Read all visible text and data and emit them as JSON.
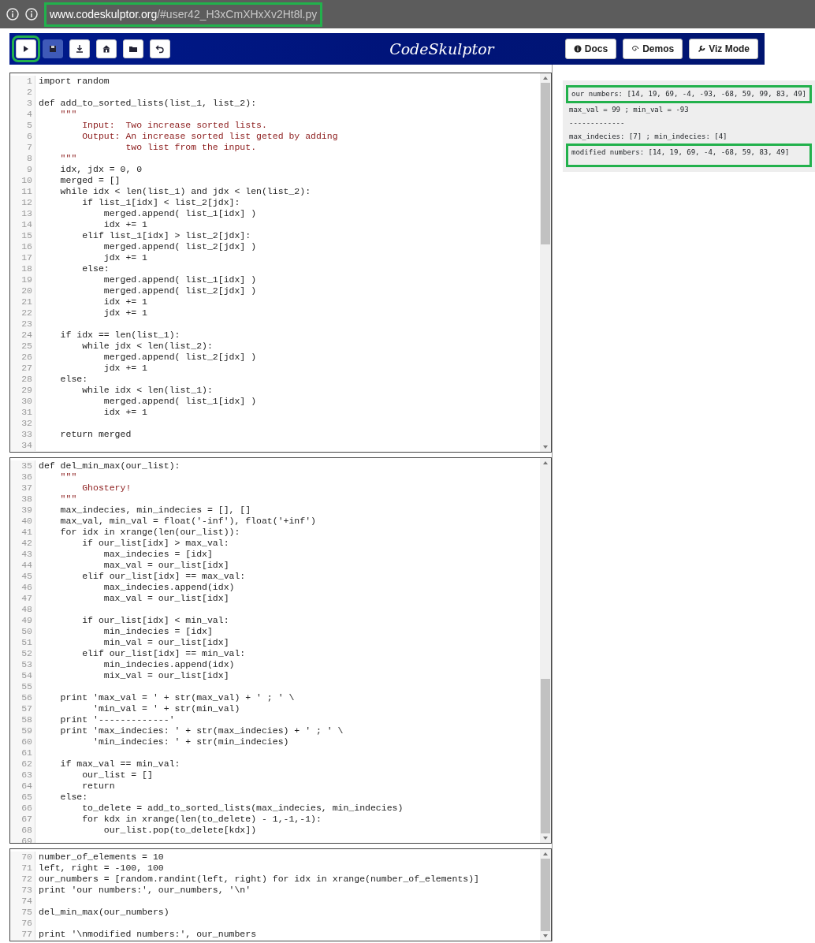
{
  "browser": {
    "url_host": "www.codeskulptor.org",
    "url_path": "/#user42_H3xCmXHxXv2Ht8l.py",
    "highlighted": true
  },
  "toolbar": {
    "tool_buttons": [
      {
        "kind": "run",
        "disabled": false,
        "highlighted": true
      },
      {
        "kind": "save",
        "disabled": true,
        "highlighted": false
      },
      {
        "kind": "download",
        "disabled": false,
        "highlighted": false
      },
      {
        "kind": "house",
        "disabled": false,
        "highlighted": false
      },
      {
        "kind": "open",
        "disabled": false,
        "highlighted": false
      },
      {
        "kind": "undo",
        "disabled": false,
        "highlighted": false
      }
    ],
    "title": "CodeSkulptor",
    "buttons": [
      {
        "label": "Docs",
        "kind": "info"
      },
      {
        "label": "Demos",
        "kind": "spiral"
      },
      {
        "label": "Viz Mode",
        "kind": "wrench"
      }
    ]
  },
  "editors": [
    {
      "lines": [
        {
          "number": "1",
          "text": "import random",
          "kind": "code"
        },
        {
          "number": "2",
          "kind": "code"
        },
        {
          "number": "3",
          "text": "def add_to_sorted_lists(list_1, list_2):",
          "kind": "code"
        },
        {
          "number": "4",
          "text": "    \"\"\"",
          "kind": "string"
        },
        {
          "number": "5",
          "text": "        Input:  Two increase sorted lists.",
          "kind": "string"
        },
        {
          "number": "6",
          "text": "        Output: An increase sorted list geted by adding",
          "kind": "string"
        },
        {
          "number": "7",
          "text": "                two list from the input.",
          "kind": "string"
        },
        {
          "number": "8",
          "text": "    \"\"\"",
          "kind": "string"
        },
        {
          "number": "9",
          "text": "    idx, jdx = 0, 0",
          "kind": "code"
        },
        {
          "number": "10",
          "text": "    merged = []",
          "kind": "code"
        },
        {
          "number": "11",
          "text": "    while idx < len(list_1) and jdx < len(list_2):",
          "kind": "code"
        },
        {
          "number": "12",
          "text": "        if list_1[idx] < list_2[jdx]:",
          "kind": "code"
        },
        {
          "number": "13",
          "text": "            merged.append( list_1[idx] )",
          "kind": "code"
        },
        {
          "number": "14",
          "text": "            idx += 1",
          "kind": "code"
        },
        {
          "number": "15",
          "text": "        elif list_1[idx] > list_2[jdx]:",
          "kind": "code"
        },
        {
          "number": "16",
          "text": "            merged.append( list_2[jdx] )",
          "kind": "code"
        },
        {
          "number": "17",
          "text": "            jdx += 1",
          "kind": "code"
        },
        {
          "number": "18",
          "text": "        else:",
          "kind": "code"
        },
        {
          "number": "19",
          "text": "            merged.append( list_1[idx] )",
          "kind": "code"
        },
        {
          "number": "20",
          "text": "            merged.append( list_2[jdx] )",
          "kind": "code"
        },
        {
          "number": "21",
          "text": "            idx += 1",
          "kind": "code"
        },
        {
          "number": "22",
          "text": "            jdx += 1",
          "kind": "code"
        },
        {
          "number": "23",
          "kind": "code"
        },
        {
          "number": "24",
          "text": "    if idx == len(list_1):",
          "kind": "code"
        },
        {
          "number": "25",
          "text": "        while jdx < len(list_2):",
          "kind": "code"
        },
        {
          "number": "26",
          "text": "            merged.append( list_2[jdx] )",
          "kind": "code"
        },
        {
          "number": "27",
          "text": "            jdx += 1",
          "kind": "code"
        },
        {
          "number": "28",
          "text": "    else:",
          "kind": "code"
        },
        {
          "number": "29",
          "text": "        while idx < len(list_1):",
          "kind": "code"
        },
        {
          "number": "30",
          "text": "            merged.append( list_1[idx] )",
          "kind": "code"
        },
        {
          "number": "31",
          "text": "            idx += 1",
          "kind": "code"
        },
        {
          "number": "32",
          "kind": "code"
        },
        {
          "number": "33",
          "text": "    return merged",
          "kind": "code"
        },
        {
          "number": "34",
          "kind": "code"
        }
      ]
    },
    {
      "lines": [
        {
          "number": "35",
          "text": "def del_min_max(our_list):",
          "kind": "code"
        },
        {
          "number": "36",
          "text": "    \"\"\"",
          "kind": "string"
        },
        {
          "number": "37",
          "text": "        Ghostery!",
          "kind": "string"
        },
        {
          "number": "38",
          "text": "    \"\"\"",
          "kind": "string"
        },
        {
          "number": "39",
          "text": "    max_indecies, min_indecies = [], []",
          "kind": "code"
        },
        {
          "number": "40",
          "text": "    max_val, min_val = float('-inf'), float('+inf')",
          "kind": "code"
        },
        {
          "number": "41",
          "text": "    for idx in xrange(len(our_list)):",
          "kind": "code"
        },
        {
          "number": "42",
          "text": "        if our_list[idx] > max_val:",
          "kind": "code"
        },
        {
          "number": "43",
          "text": "            max_indecies = [idx]",
          "kind": "code"
        },
        {
          "number": "44",
          "text": "            max_val = our_list[idx]",
          "kind": "code"
        },
        {
          "number": "45",
          "text": "        elif our_list[idx] == max_val:",
          "kind": "code"
        },
        {
          "number": "46",
          "text": "            max_indecies.append(idx)",
          "kind": "code"
        },
        {
          "number": "47",
          "text": "            max_val = our_list[idx]",
          "kind": "code"
        },
        {
          "number": "48",
          "kind": "code"
        },
        {
          "number": "49",
          "text": "        if our_list[idx] < min_val:",
          "kind": "code"
        },
        {
          "number": "50",
          "text": "            min_indecies = [idx]",
          "kind": "code"
        },
        {
          "number": "51",
          "text": "            min_val = our_list[idx]",
          "kind": "code"
        },
        {
          "number": "52",
          "text": "        elif our_list[idx] == min_val:",
          "kind": "code"
        },
        {
          "number": "53",
          "text": "            min_indecies.append(idx)",
          "kind": "code"
        },
        {
          "number": "54",
          "text": "            mix_val = our_list[idx]",
          "kind": "code"
        },
        {
          "number": "55",
          "kind": "code"
        },
        {
          "number": "56",
          "text": "    print 'max_val = ' + str(max_val) + ' ; ' \\",
          "kind": "code"
        },
        {
          "number": "57",
          "text": "          'min_val = ' + str(min_val)",
          "kind": "code"
        },
        {
          "number": "58",
          "text": "    print '-------------'",
          "kind": "code"
        },
        {
          "number": "59",
          "text": "    print 'max_indecies: ' + str(max_indecies) + ' ; ' \\",
          "kind": "code"
        },
        {
          "number": "60",
          "text": "          'min_indecies: ' + str(min_indecies)",
          "kind": "code"
        },
        {
          "number": "61",
          "kind": "code"
        },
        {
          "number": "62",
          "text": "    if max_val == min_val:",
          "kind": "code"
        },
        {
          "number": "63",
          "text": "        our_list = []",
          "kind": "code"
        },
        {
          "number": "64",
          "text": "        return",
          "kind": "code"
        },
        {
          "number": "65",
          "text": "    else:",
          "kind": "code"
        },
        {
          "number": "66",
          "text": "        to_delete = add_to_sorted_lists(max_indecies, min_indecies)",
          "kind": "code"
        },
        {
          "number": "67",
          "text": "        for kdx in xrange(len(to_delete) - 1,-1,-1):",
          "kind": "code"
        },
        {
          "number": "68",
          "text": "            our_list.pop(to_delete[kdx])",
          "kind": "code"
        },
        {
          "number": "69",
          "kind": "code"
        }
      ]
    },
    {
      "lines": [
        {
          "number": "70",
          "text": "number_of_elements = 10",
          "kind": "code"
        },
        {
          "number": "71",
          "text": "left, right = -100, 100",
          "kind": "code"
        },
        {
          "number": "72",
          "text": "our_numbers = [random.randint(left, right) for idx in xrange(number_of_elements)]",
          "kind": "code"
        },
        {
          "number": "73",
          "text": "print 'our numbers:', our_numbers, '\\n'",
          "kind": "code"
        },
        {
          "number": "74",
          "kind": "code"
        },
        {
          "number": "75",
          "text": "del_min_max(our_numbers)",
          "kind": "code"
        },
        {
          "number": "76",
          "kind": "code"
        },
        {
          "number": "77",
          "text": "print '\\nmodified numbers:', our_numbers",
          "kind": "code"
        }
      ]
    }
  ],
  "output": {
    "lines": [
      {
        "text": "our numbers: [14, 19, 69, -4, -93, -68, 59, 99, 83, 49]",
        "highlighted": true
      },
      {
        "text": "max_val = 99 ; min_val = -93",
        "highlighted": false
      },
      {
        "text": "-------------",
        "highlighted": false
      },
      {
        "text": "max_indecies: [7] ; min_indecies: [4]",
        "highlighted": false
      },
      {
        "text": "modified numbers: [14, 19, 69, -4, -68, 59, 83, 49]",
        "highlighted": true
      }
    ]
  }
}
